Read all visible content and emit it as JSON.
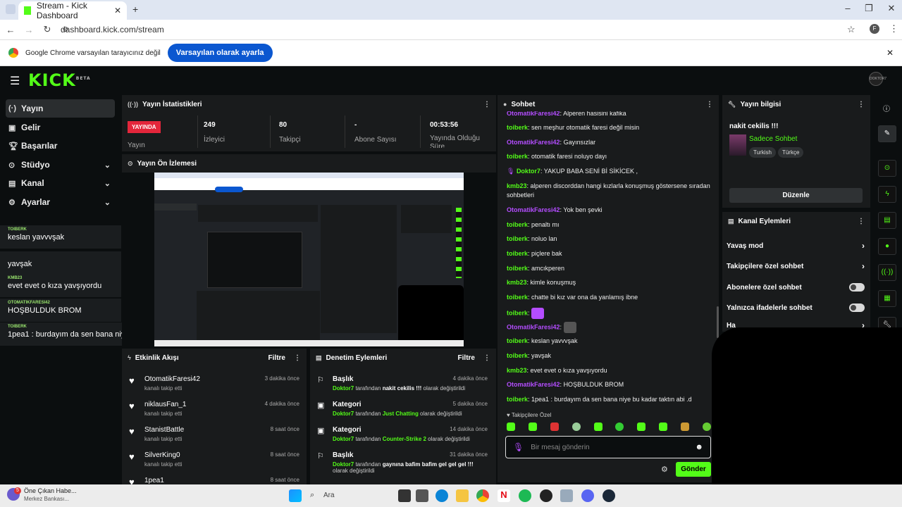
{
  "browser": {
    "tab_title": "Stream - Kick Dashboard",
    "url": "dashboard.kick.com/stream",
    "profile": "F",
    "infobar_text": "Google Chrome varsayılan tarayıcınız değil",
    "infobar_button": "Varsayılan olarak ayarla"
  },
  "brand": {
    "logo": "KICK",
    "beta": "BETA",
    "avatar_text": "DOKTOR7"
  },
  "sidebar": {
    "items": [
      {
        "label": "Yayın",
        "icon": "broadcast-icon"
      },
      {
        "label": "Gelir",
        "icon": "money-icon"
      },
      {
        "label": "Başarılar",
        "icon": "trophy-icon"
      },
      {
        "label": "Stüdyo",
        "icon": "studio-icon"
      },
      {
        "label": "Kanal",
        "icon": "channel-icon"
      },
      {
        "label": "Ayarlar",
        "icon": "gear-icon"
      }
    ],
    "overlay": [
      {
        "user": "TOIBERK",
        "text": "keslan yavvvşak"
      },
      {
        "user": "",
        "text": "yavşak"
      },
      {
        "user": "KMB23",
        "text": "evet evet o kıza yavşıyordu"
      },
      {
        "user": "OTOMATIKFARESI42",
        "text": "HOŞBULDUK BROM"
      },
      {
        "user": "TOIBERK",
        "text": "1pea1 : burdayım da sen bana niye bu kadar taktın abi .d"
      }
    ]
  },
  "stats": {
    "title": "Yayın İstatistikleri",
    "live_badge": "YAYINDA",
    "live_label": "Yayın",
    "items": [
      {
        "value": "249",
        "label": "İzleyici"
      },
      {
        "value": "80",
        "label": "Takipçi"
      },
      {
        "value": "-",
        "label": "Abone Sayısı"
      },
      {
        "value": "00:53:56",
        "label": "Yayında Olduğu Süre"
      }
    ]
  },
  "preview": {
    "title": "Yayın Ön İzlemesi"
  },
  "activity": {
    "title": "Etkinlik Akışı",
    "filter": "Filtre",
    "rows": [
      {
        "name": "OtomatikFaresi42",
        "sub": "kanalı takip etti",
        "time": "3 dakika önce"
      },
      {
        "name": "niklausFan_1",
        "sub": "kanalı takip etti",
        "time": "4 dakika önce"
      },
      {
        "name": "StanistBattle",
        "sub": "kanalı takip etti",
        "time": "8 saat önce"
      },
      {
        "name": "SilverKing0",
        "sub": "kanalı takip etti",
        "time": "8 saat önce"
      },
      {
        "name": "1pea1",
        "sub": "",
        "time": "8 saat önce"
      }
    ]
  },
  "moderation": {
    "title": "Denetim Eylemleri",
    "filter": "Filtre",
    "rows": [
      {
        "name": "Başlık",
        "user": "Doktor7",
        "mid": " tarafından ",
        "val": "nakit cekilis !!!",
        "tail": " olarak değiştirildi",
        "time": "4 dakika önce",
        "green": false
      },
      {
        "name": "Kategori",
        "user": "Doktor7",
        "mid": " tarafından ",
        "val": "Just Chatting",
        "tail": " olarak değiştirildi",
        "time": "5 dakika önce",
        "green": true
      },
      {
        "name": "Kategori",
        "user": "Doktor7",
        "mid": " tarafından ",
        "val": "Counter-Strike 2",
        "tail": " olarak değiştirildi",
        "time": "14 dakika önce",
        "green": true
      },
      {
        "name": "Başlık",
        "user": "Doktor7",
        "mid": " tarafından ",
        "val": "gaynına bafim bafim gel gel gel !!!",
        "tail": " olarak değiştirildi",
        "time": "31 dakika önce",
        "green": false
      }
    ]
  },
  "chat": {
    "title": "Sohbet",
    "top_cut": {
      "user": "OtomatikFaresi42",
      "text": "Alperen hasisini kafika"
    },
    "messages": [
      {
        "user": "toiberk",
        "color": "green",
        "text": "sen meşhur otomatik faresi değil misin"
      },
      {
        "user": "OtomatikFaresi42",
        "color": "purple",
        "text": "Gayınsızlar"
      },
      {
        "user": "toiberk",
        "color": "green",
        "text": "otomatik faresi noluyo dayı"
      },
      {
        "user": "Doktor7",
        "color": "green",
        "text": "YAKUP BABA SENİ Bİ SİKİCEK ,",
        "badge": true
      },
      {
        "user": "kmb23",
        "color": "green",
        "text": "alperen discorddan hangi kızlarla konuşmuş göstersene sıradan sohbetleri"
      },
      {
        "user": "OtomatikFaresi42",
        "color": "purple",
        "text": "Yok ben şevki"
      },
      {
        "user": "toiberk",
        "color": "green",
        "text": "penaltı mı"
      },
      {
        "user": "toiberk",
        "color": "green",
        "text": "noluo lan"
      },
      {
        "user": "toiberk",
        "color": "green",
        "text": "piçlere bak"
      },
      {
        "user": "toiberk",
        "color": "green",
        "text": "amcıkperen"
      },
      {
        "user": "kmb23",
        "color": "green",
        "text": "kimle konuşmuş"
      },
      {
        "user": "toiberk",
        "color": "green",
        "text": "chatte bi kız var ona da yanlamış ibne"
      },
      {
        "user": "toiberk",
        "color": "green",
        "text": ""
      },
      {
        "user": "OtomatikFaresi42",
        "color": "purple",
        "text": ""
      },
      {
        "user": "toiberk",
        "color": "green",
        "text": "keslan yavvvşak"
      },
      {
        "user": "toiberk",
        "color": "green",
        "text": "yavşak"
      },
      {
        "user": "kmb23",
        "color": "green",
        "text": "evet evet o kıza yavşıyordu"
      },
      {
        "user": "OtomatikFaresi42",
        "color": "purple",
        "text": "HOŞBULDUK BROM"
      },
      {
        "user": "toiberk",
        "color": "green",
        "text": "1pea1 : burdayım da sen bana niye bu kadar taktın abi .d"
      }
    ],
    "followers_only": "Takipçilere Özel",
    "input_placeholder": "Bir mesaj gönderin",
    "send": "Gönder"
  },
  "stream_info": {
    "title": "Yayın bilgisi",
    "stream_title": "nakit cekilis !!!",
    "category": "Sadece Sohbet",
    "tags": [
      "Turkish",
      "Türkçe"
    ],
    "edit": "Düzenle"
  },
  "channel_actions": {
    "title": "Kanal Eylemleri",
    "items": [
      {
        "label": "Yavaş mod",
        "kind": "chevron"
      },
      {
        "label": "Takipçilere özel sohbet",
        "kind": "chevron"
      },
      {
        "label": "Abonelere özel sohbet",
        "kind": "toggle"
      },
      {
        "label": "Yalnızca ifadelerle sohbet",
        "kind": "toggle"
      },
      {
        "label": "Ha",
        "kind": "chevron"
      }
    ]
  },
  "taskbar": {
    "news_title": "Öne Çıkan Habe...",
    "news_sub": "Merkez Bankası...",
    "news_badge": "5",
    "search": "Ara"
  },
  "colors": {
    "accent": "#53fc18",
    "purple": "#b44dff",
    "live": "#e3263b"
  }
}
